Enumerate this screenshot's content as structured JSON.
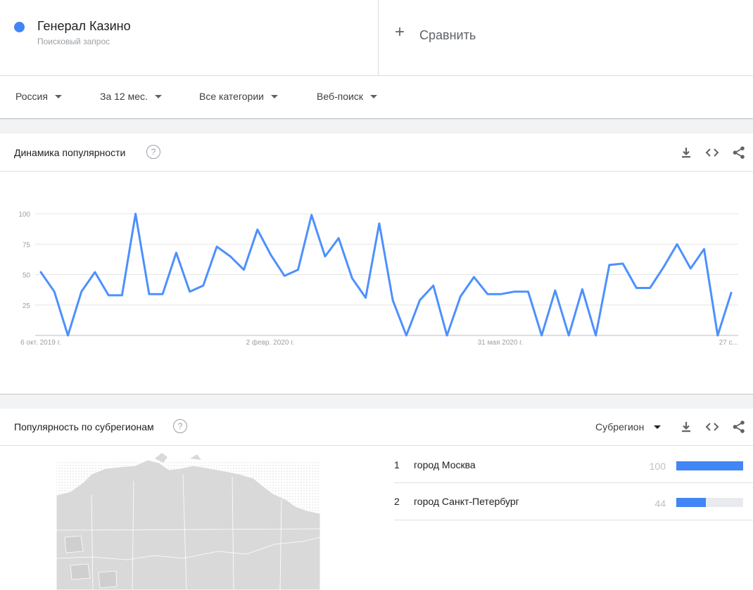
{
  "search_term": {
    "name": "Генерал Казино",
    "type": "Поисковый запрос",
    "color": "#4285f4"
  },
  "compare": {
    "label": "Сравнить"
  },
  "filters": {
    "region": "Россия",
    "period": "За 12 мес.",
    "category": "Все категории",
    "search_type": "Веб-поиск"
  },
  "trend_card": {
    "title": "Динамика популярности",
    "help_glyph": "?",
    "icons": [
      "download-icon",
      "embed-icon",
      "share-icon"
    ]
  },
  "chart_data": {
    "type": "line",
    "x_tick_labels": [
      "6 окт. 2019 г.",
      "2 февр. 2020 г.",
      "31 мая 2020 г.",
      "27 с..."
    ],
    "y_tick_labels": [
      "100",
      "75",
      "50",
      "25"
    ],
    "ylim": [
      0,
      100
    ],
    "grid": true,
    "series": [
      {
        "color": "#4d90fe",
        "values": [
          52,
          36,
          0,
          36,
          52,
          33,
          33,
          100,
          34,
          34,
          68,
          36,
          41,
          73,
          65,
          54,
          87,
          66,
          49,
          54,
          99,
          65,
          80,
          47,
          31,
          92,
          29,
          0,
          29,
          41,
          0,
          32,
          48,
          34,
          34,
          36,
          36,
          0,
          37,
          0,
          38,
          0,
          58,
          59,
          39,
          39,
          56,
          75,
          55,
          71,
          0,
          35
        ]
      }
    ]
  },
  "region_card": {
    "title": "Популярность по субрегионам",
    "help_glyph": "?",
    "granularity": "Субрегион",
    "icons": [
      "download-icon",
      "embed-icon",
      "share-icon"
    ],
    "rows": [
      {
        "rank": "1",
        "name": "город Москва",
        "value": "100",
        "fraction": 1.0
      },
      {
        "rank": "2",
        "name": "город Санкт-Петербург",
        "value": "44",
        "fraction": 0.44
      }
    ]
  }
}
